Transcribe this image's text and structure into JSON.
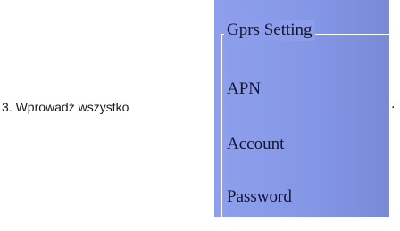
{
  "instruction": {
    "text": "3. Wprowadź wszystko"
  },
  "panel": {
    "group_title": "Gprs Setting",
    "fields": [
      {
        "label": "APN"
      },
      {
        "label": "Account"
      },
      {
        "label": "Password"
      }
    ],
    "background_color": "#8497e6"
  },
  "trailing_mark": "."
}
